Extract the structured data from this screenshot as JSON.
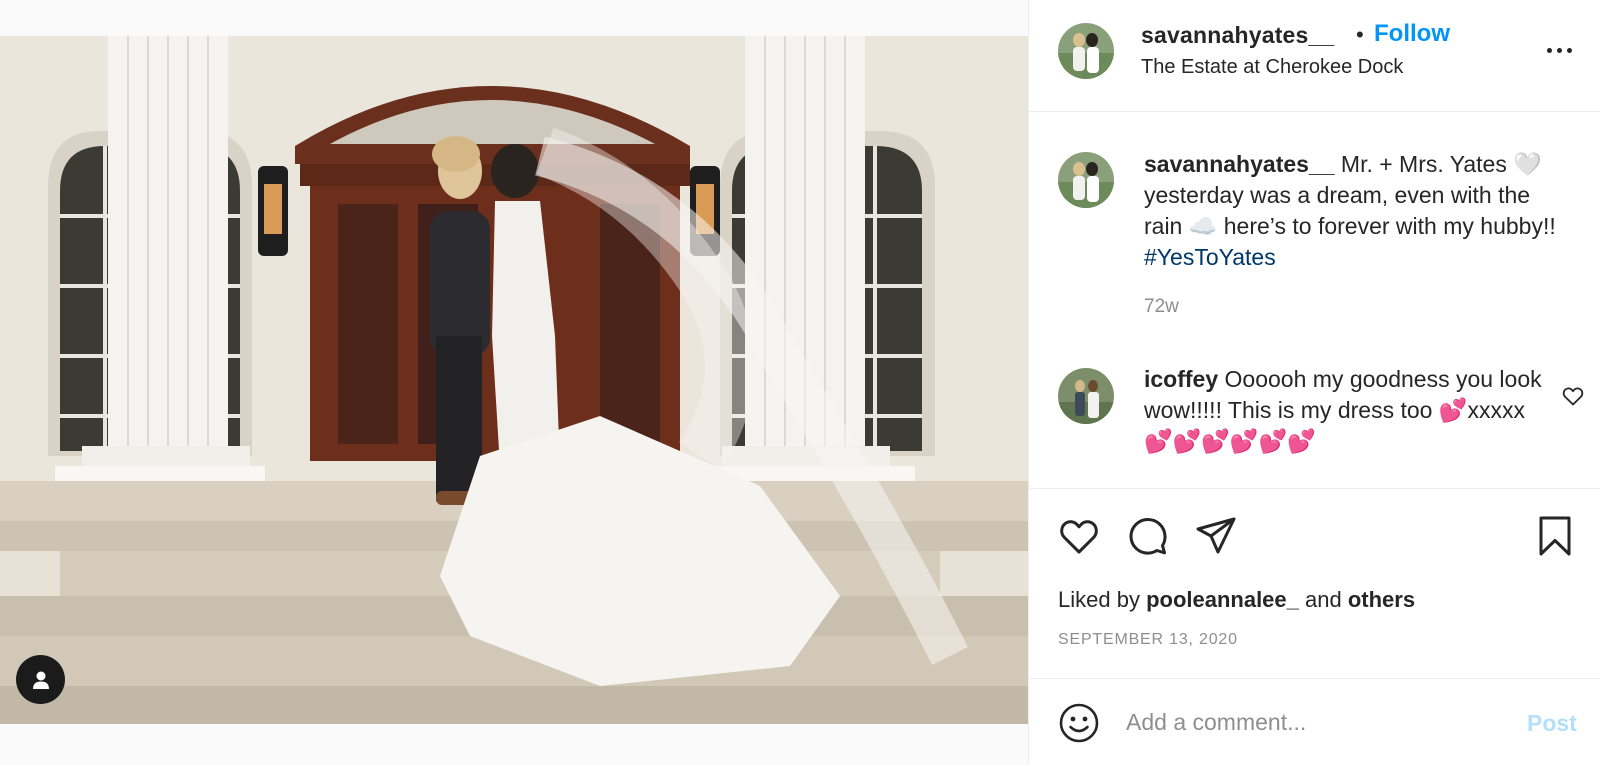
{
  "post": {
    "username": "savannahyates__",
    "location": "The Estate at Cherokee Dock",
    "follow_label": "Follow",
    "dot": "•"
  },
  "caption": {
    "username": "savannahyates__",
    "text": " Mr. + Mrs. Yates 🤍 yesterday was a dream, even with the rain ☁️ here’s to forever with my hubby!! ",
    "hashtag": "#YesToYates",
    "time": "72w"
  },
  "comment": {
    "username": "icoffey",
    "text": " Oooooh my goodness you look wow!!!!! This is my dress too 💕xxxxx💕💕💕💕💕💕"
  },
  "likes": {
    "prefix": "Liked by ",
    "user": "pooleannalee_",
    "middle": " and ",
    "others": "others"
  },
  "date": "SEPTEMBER 13, 2020",
  "add_comment": {
    "placeholder": "Add a comment...",
    "post_label": "Post"
  },
  "icons": {
    "more": "more-options-icon",
    "like": "heart-icon",
    "comment": "comment-icon",
    "share": "share-icon",
    "save": "bookmark-icon",
    "emoji": "emoji-icon",
    "tag": "user-tag-icon"
  },
  "colors": {
    "follow": "#0095f6",
    "hashtag": "#00376b",
    "post_disabled": "#b2dffc",
    "muted": "#8e8e8e"
  }
}
